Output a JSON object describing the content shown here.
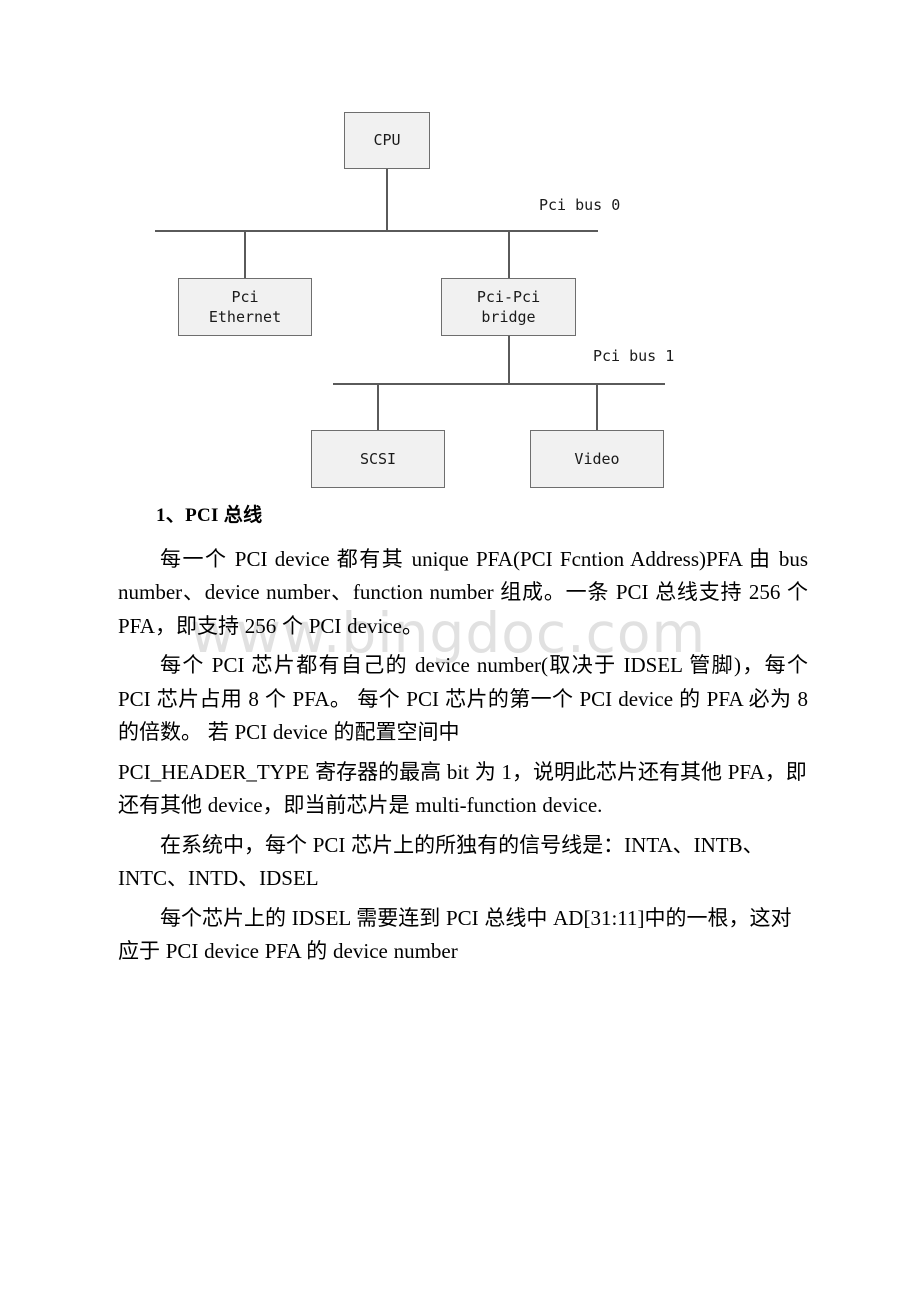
{
  "watermark": {
    "text": "www.bingdoc.com",
    "color": "#dcdcdc"
  },
  "diagram": {
    "name": "pci-bus-topology-diagram",
    "node_fill": "#f1f1f1",
    "node_border": "#6e6e6e",
    "wire_color": "#5a5a5a",
    "nodes": [
      {
        "id": "cpu",
        "label": "CPU"
      },
      {
        "id": "ethernet",
        "label": "Pci\nEthernet"
      },
      {
        "id": "bridge",
        "label": "Pci-Pci\nbridge"
      },
      {
        "id": "scsi",
        "label": "SCSI"
      },
      {
        "id": "video",
        "label": "Video"
      }
    ],
    "bus_labels": [
      {
        "id": "bus0",
        "label": "Pci bus 0"
      },
      {
        "id": "bus1",
        "label": "Pci bus 1"
      }
    ]
  },
  "content": {
    "heading": "1、PCI 总线",
    "paragraphs": [
      "每一个 PCI device 都有其 unique PFA(PCI Fcntion Address)PFA 由 bus number、device number、function number 组成。一条 PCI 总线支持 256 个 PFA，即支持 256 个 PCI device。",
      "每个 PCI 芯片都有自己的 device number(取决于 IDSEL 管脚)，每个 PCI 芯片占用 8 个 PFA。 每个 PCI 芯片的第一个 PCI device 的 PFA 必为 8 的倍数。 若 PCI device 的配置空间中",
      "PCI_HEADER_TYPE 寄存器的最高 bit 为 1，说明此芯片还有其他 PFA，即还有其他 device，即当前芯片是 multi-function device.",
      "在系统中，每个 PCI 芯片上的所独有的信号线是：INTA、INTB、INTC、INTD、IDSEL",
      "每个芯片上的 IDSEL 需要连到 PCI 总线中 AD[31:11]中的一根，这对应于 PCI device PFA 的 device number"
    ]
  }
}
